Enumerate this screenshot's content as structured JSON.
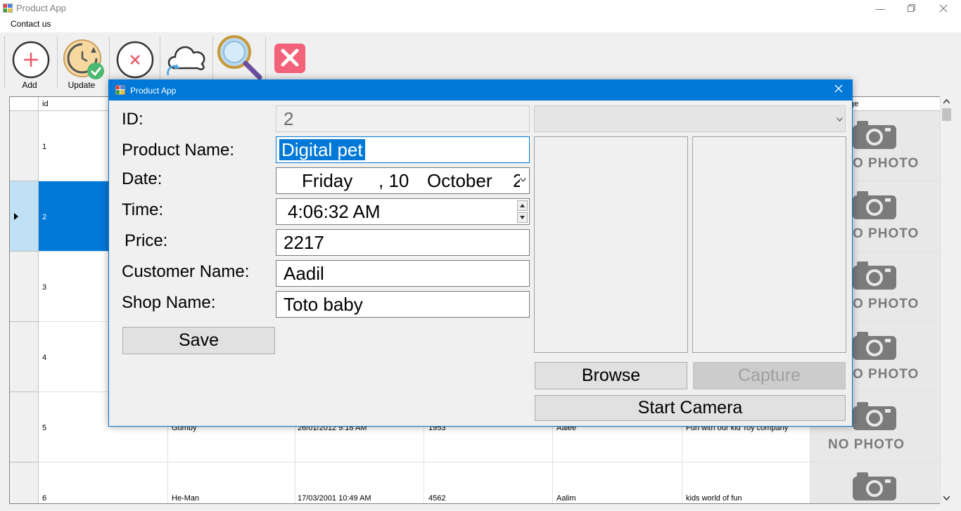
{
  "window": {
    "title": "Product App"
  },
  "menu": {
    "contact_us": "Contact us"
  },
  "toolbar": {
    "add_label": "Add",
    "update_label": "Update"
  },
  "grid": {
    "header_id": "id",
    "header_image": "ge",
    "rows": [
      {
        "id": "1"
      },
      {
        "id": "2"
      },
      {
        "id": "3"
      },
      {
        "id": "4"
      },
      {
        "id": "5",
        "name": "Gumby",
        "date": "26/01/2012 9:18 AM",
        "price": "1953",
        "customer": "Aalee",
        "shop": "Fun with our kid Toy company"
      },
      {
        "id": "6",
        "name": "He-Man",
        "date": "17/03/2001 10:49 AM",
        "price": "4562",
        "customer": "Aalim",
        "shop": "kids world of fun"
      }
    ],
    "no_photo_text": "NO PHOTO",
    "no_photo_partial": "O PHOTO"
  },
  "dialog": {
    "title": "Product App",
    "labels": {
      "id": "ID:",
      "product_name": "Product Name:",
      "date": "Date:",
      "time": "Time:",
      "price": "Price:",
      "customer_name": "Customer Name:",
      "shop_name": "Shop Name:"
    },
    "values": {
      "id": "2",
      "product_name": "Digital pet",
      "date_day": "Friday",
      "date_sep": ", 10",
      "date_month": "October",
      "date_year_partial": "2",
      "time": "4:06:32 AM",
      "price": "2217",
      "customer_name": "Aadil",
      "shop_name": "Toto baby"
    },
    "buttons": {
      "save": "Save",
      "browse": "Browse",
      "capture": "Capture",
      "start_camera": "Start Camera"
    }
  },
  "colors": {
    "accent": "#0078d7",
    "selection": "#0078d7",
    "no_photo_bg": "#e8e8e8"
  }
}
